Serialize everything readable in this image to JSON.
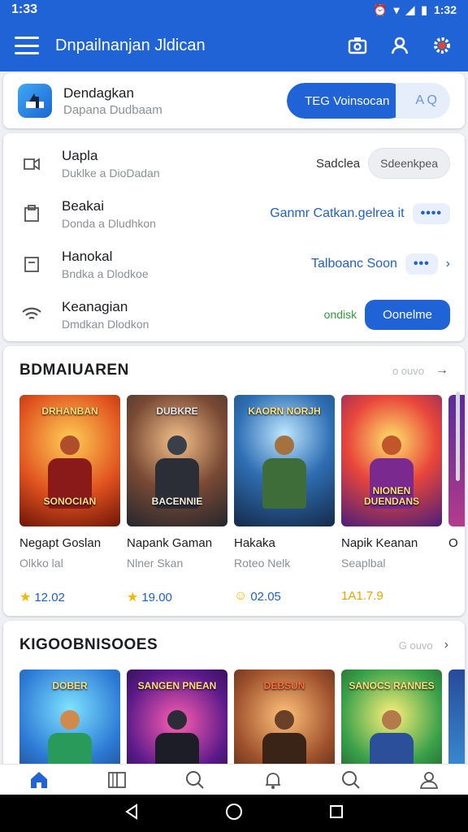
{
  "status_bar": {
    "time_left": "1:33",
    "time_right": "1:32"
  },
  "app_bar": {
    "title": "Dnpailnanjan Jldican"
  },
  "account": {
    "title": "Dendagkan",
    "subtitle": "Dapana Dudbaam",
    "button_primary": "TEG Voinsocan",
    "button_secondary": "A Q"
  },
  "settings": [
    {
      "title": "Uapla",
      "subtitle": "Duklke a DioDadan",
      "value": "Sadclea",
      "action": "Sdeenkpea"
    },
    {
      "title": "Beakai",
      "subtitle": "Donda a Dludhkon",
      "value": "Ganmr Catkan.gelrea it",
      "action": "••••"
    },
    {
      "title": "Hanokal",
      "subtitle": "Bndka a Dlodkoe",
      "value": "Talboanc Soon",
      "action": "•••"
    },
    {
      "title": "Keanagian",
      "subtitle": "Dmdkan Dlodkon",
      "value": "ondisk",
      "action": "Oonelme"
    }
  ],
  "section1": {
    "heading": "BDMAIUAREN",
    "more": "o ouvo",
    "games": [
      {
        "cover_top": "DRHANBAN",
        "cover_bottom": "SONOCIAN",
        "name": "Negapt Goslan",
        "sub": "Olkko lal",
        "rating": "12.02",
        "icon": "star-icon"
      },
      {
        "cover_top": "DUBKRE",
        "cover_bottom": "BACENNIE",
        "name": "Napank Gaman",
        "sub": "Nlner Skan",
        "rating": "19.00",
        "icon": "star-icon"
      },
      {
        "cover_top": "KAORN NORJH",
        "cover_bottom": "",
        "name": "Hakaka",
        "sub": "Roteo Nelk",
        "rating": "02.05",
        "icon": "smile-icon"
      },
      {
        "cover_top": "",
        "cover_bottom": "NIONEN DUENDANS",
        "name": "Napik Keanan",
        "sub": "Seaplbal",
        "rating": "1A1.7.9",
        "icon": ""
      },
      {
        "cover_top": "",
        "cover_bottom": "",
        "name": "O",
        "sub": "",
        "rating": "",
        "icon": ""
      }
    ]
  },
  "section2": {
    "heading": "KIGOOBNISOOES",
    "more": "G ouvo",
    "games": [
      {
        "cover_top": "DOBER",
        "cover_bottom": ""
      },
      {
        "cover_top": "SANGEN PNEAN",
        "cover_bottom": ""
      },
      {
        "cover_top": "DEBSUN",
        "cover_bottom": ""
      },
      {
        "cover_top": "SANOCS RANNES",
        "cover_bottom": ""
      },
      {
        "cover_top": "",
        "cover_bottom": ""
      }
    ]
  },
  "bottom_nav": [
    "home-icon",
    "book-icon",
    "search-icon",
    "bell-icon",
    "search-icon",
    "profile-icon"
  ],
  "colors": {
    "primary": "#1f63d6",
    "accent_green": "#2e9d3a",
    "star": "#f5b800"
  }
}
